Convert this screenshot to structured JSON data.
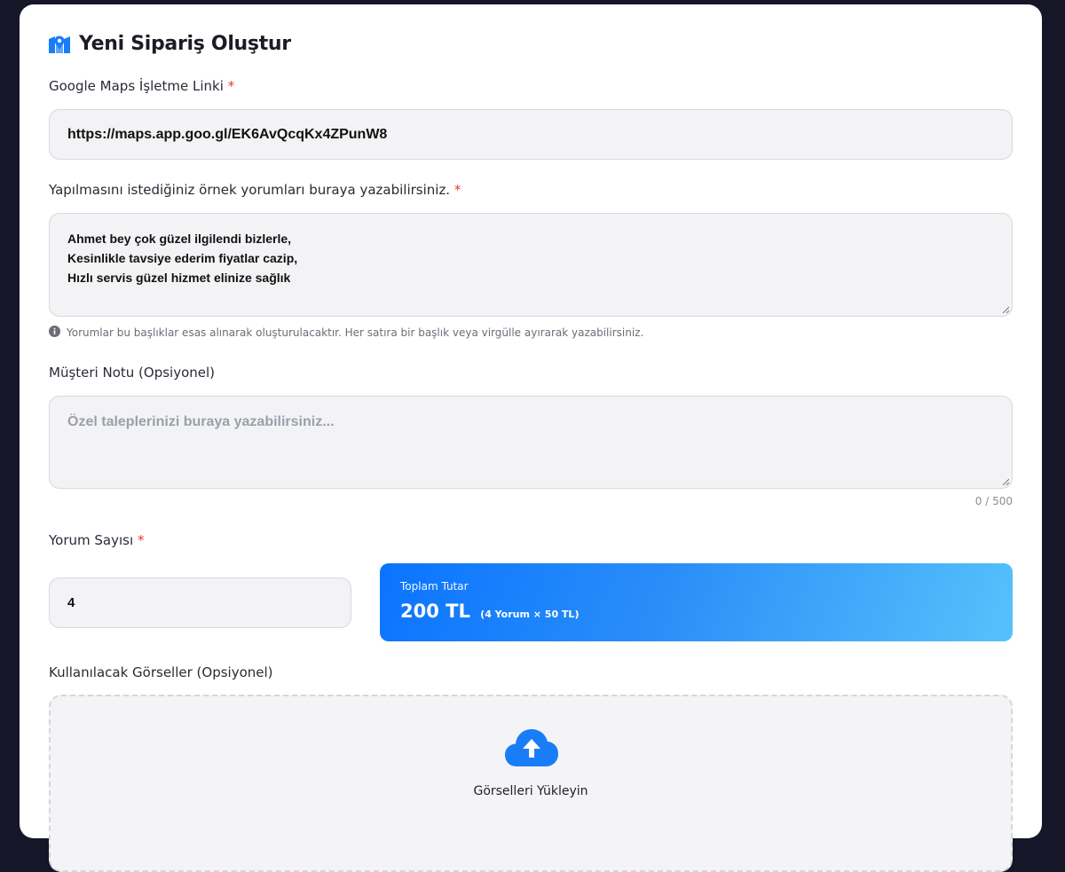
{
  "page": {
    "title": "Yeni Sipariş Oluştur",
    "title_icon": "map-icon",
    "accent_color": "#1a7df8"
  },
  "form": {
    "maps_link": {
      "label": "Google Maps İşletme Linki",
      "required_mark": "*",
      "value": "https://maps.app.goo.gl/EK6AvQcqKx4ZPunW8"
    },
    "sample_reviews": {
      "label": "Yapılmasını istediğiniz örnek yorumları buraya yazabilirsiniz.",
      "required_mark": "*",
      "lines": [
        "Ahmet bey çok güzel ilgilendi bizlerle,",
        "Kesinlikle tavsiye ederim fiyatlar cazip,",
        "Hızlı servis güzel hizmet elinize sağlık"
      ],
      "hint": "Yorumlar bu başlıklar esas alınarak oluşturulacaktır. Her satıra bir başlık veya virgülle ayırarak yazabilirsiniz.",
      "hint_icon": "info-icon"
    },
    "customer_note": {
      "label": "Müşteri Notu (Opsiyonel)",
      "placeholder": "Özel taleplerinizi buraya yazabilirsiniz...",
      "counter": "0 / 500"
    },
    "review_count": {
      "label": "Yorum Sayısı",
      "required_mark": "*",
      "value": "4"
    },
    "total": {
      "label": "Toplam Tutar",
      "amount": "200 TL",
      "detail": "(4 Yorum × 50 TL)"
    },
    "images": {
      "label": "Kullanılacak Görseller (Opsiyonel)",
      "upload_title": "Görselleri Yükleyin",
      "upload_icon": "cloud-upload-icon"
    }
  }
}
